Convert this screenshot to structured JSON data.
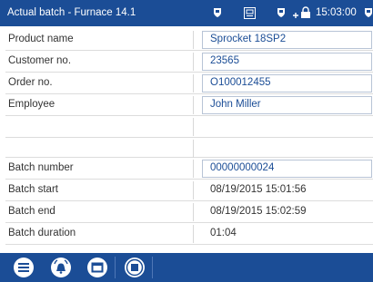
{
  "titlebar": {
    "title": "Actual batch - Furnace 14.1",
    "time": "15:03:00",
    "icons": [
      "shield-icon",
      "settings-box-icon",
      "shield-icon",
      "lock-network-icon",
      "shield-icon"
    ]
  },
  "fields": [
    {
      "label": "Product name",
      "value": "Sprocket 18SP2"
    },
    {
      "label": "Customer no.",
      "value": "23565"
    },
    {
      "label": "Order no.",
      "value": "O100012455"
    },
    {
      "label": "Employee",
      "value": "John Miller"
    },
    {
      "label": "",
      "value": ""
    },
    {
      "label": "",
      "value": ""
    },
    {
      "label": "Batch number",
      "value": "00000000024"
    },
    {
      "label": "Batch start",
      "value": "08/19/2015 15:01:56"
    },
    {
      "label": "Batch end",
      "value": "08/19/2015 15:02:59"
    },
    {
      "label": "Batch duration",
      "value": "01:04"
    }
  ],
  "toolbar": {
    "buttons": [
      "list-icon",
      "alarm-bell-icon",
      "window-icon",
      "stop-icon"
    ]
  },
  "colors": {
    "accent": "#1b4d96",
    "value_text": "#1b4d96"
  }
}
